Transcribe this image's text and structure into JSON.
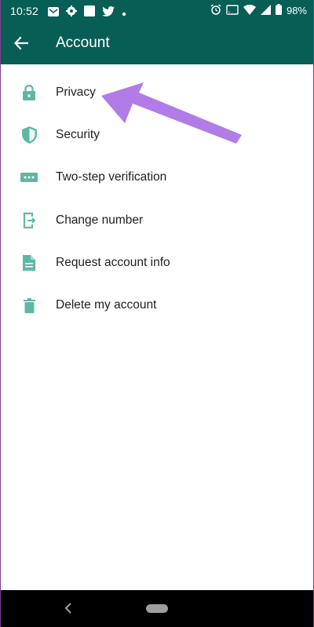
{
  "status_bar": {
    "time": "10:52",
    "battery": "98%",
    "left_icons": [
      "email-icon",
      "settings-icon",
      "square-icon",
      "twitter-icon",
      "dot-icon"
    ],
    "right_icons": [
      "alarm-icon",
      "cast-icon",
      "wifi-icon",
      "signal-icon",
      "battery-icon"
    ]
  },
  "app_bar": {
    "title": "Account",
    "back_icon": "arrow-left-icon",
    "background": "#075e54"
  },
  "menu": {
    "icon_color": "#5fb7a3",
    "items": [
      {
        "label": "Privacy",
        "icon": "lock-icon"
      },
      {
        "label": "Security",
        "icon": "shield-icon"
      },
      {
        "label": "Two-step verification",
        "icon": "password-dots-icon"
      },
      {
        "label": "Change number",
        "icon": "phone-exit-icon"
      },
      {
        "label": "Request account info",
        "icon": "document-icon"
      },
      {
        "label": "Delete my account",
        "icon": "trash-icon"
      }
    ]
  },
  "annotation": {
    "arrow_color": "#b17be8",
    "points_to": "Privacy"
  },
  "nav_bar": {
    "back_icon": "chevron-left-icon",
    "home_icon": "home-pill-icon"
  }
}
